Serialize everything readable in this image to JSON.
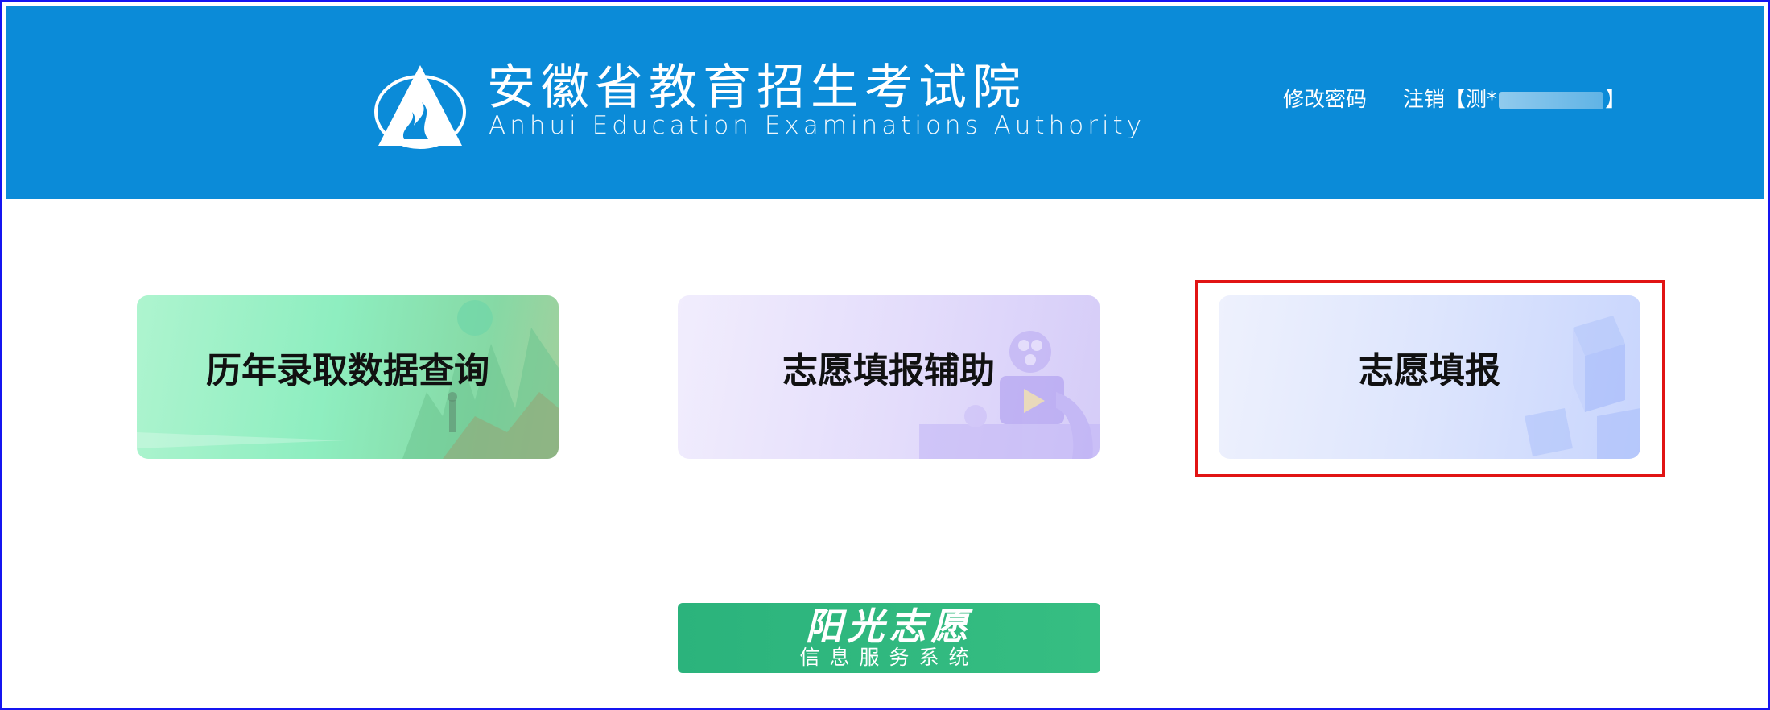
{
  "header": {
    "org_name_cn": "安徽省教育招生考试院",
    "org_name_en": "Anhui Education Examinations Authority",
    "change_password": "修改密码",
    "logout_prefix": "注销【测*",
    "logout_suffix": "】",
    "background_color": "#0b8bd8"
  },
  "cards": [
    {
      "label": "历年录取数据查询",
      "icon": "landscape-illustration"
    },
    {
      "label": "志愿填报辅助",
      "icon": "film-projector-illustration"
    },
    {
      "label": "志愿填报",
      "icon": "cubes-illustration",
      "highlighted": true,
      "highlight_color": "#e11414"
    }
  ],
  "banner": {
    "title": "阳光志愿",
    "subtitle": "信息服务系统",
    "color": "#2bb37c"
  }
}
